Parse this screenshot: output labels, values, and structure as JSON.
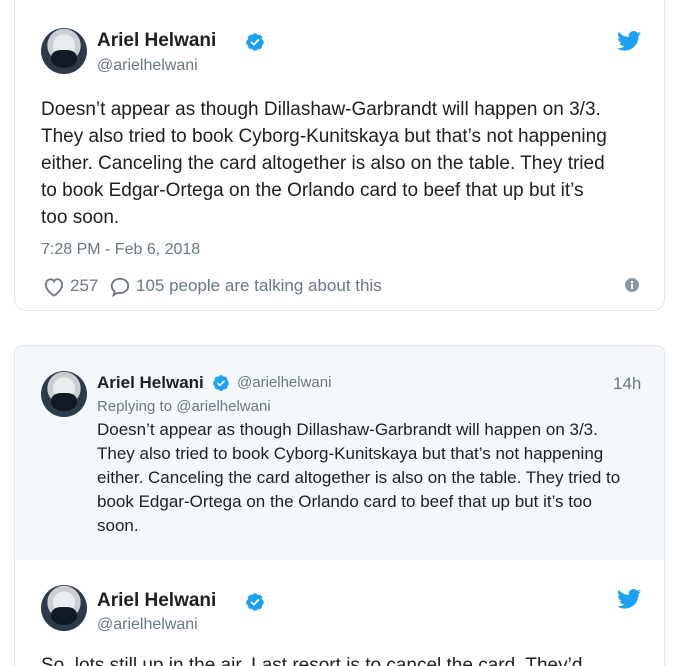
{
  "tweet1": {
    "author_name": "Ariel Helwani",
    "author_handle": "@arielhelwani",
    "text_lines": [
      "Doesn’t appear as though Dillashaw-Garbrandt will happen on 3/3.",
      "They also tried to book Cyborg-Kunitskaya but that’s not happening",
      "either. Canceling the card altogether is also on the table. They tried",
      "to book Edgar-Ortega on the Orlando card to beef that up but it’s",
      "too soon."
    ],
    "timestamp": "7:28 PM - Feb 6, 2018",
    "like_count": "257",
    "talking_text": "105 people are talking about this"
  },
  "reply": {
    "author_name": "Ariel Helwani",
    "author_handle": "@arielhelwani",
    "time": "14h",
    "replying_to": "Replying to @arielhelwani",
    "text_lines": [
      "Doesn’t appear as though Dillashaw-Garbrandt will happen on 3/3.",
      "They also tried to book Cyborg-Kunitskaya but that’s not happening",
      "either. Canceling the card altogether is also on the table. They tried to",
      "book Edgar-Ortega on the Orlando card to beef that up but it’s too",
      "soon."
    ]
  },
  "tweet2": {
    "author_name": "Ariel Helwani",
    "author_handle": "@arielhelwani",
    "first_line_partial": "So, lots still up in the air. Last resort is to cancel the card. They’d"
  },
  "colors": {
    "twitter_blue": "#1da1f2",
    "text": "#1c2022",
    "muted": "#697882",
    "border": "#e1e8ed",
    "reply_bg": "#f5f8fa"
  },
  "icons": [
    "twitter-bird-icon",
    "verified-badge-icon",
    "heart-icon",
    "speech-bubble-icon",
    "info-icon"
  ]
}
